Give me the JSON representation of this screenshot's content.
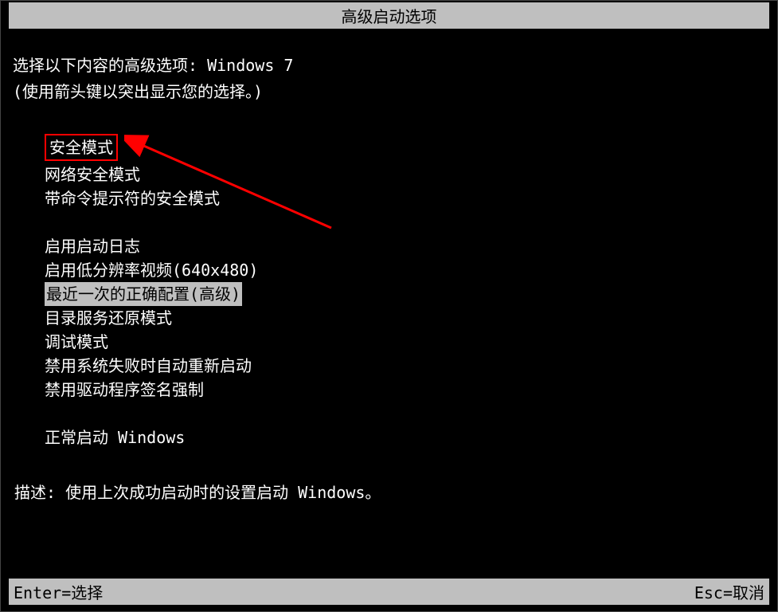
{
  "title": "高级启动选项",
  "prompt": {
    "line1_prefix": "选择以下内容的高级选项: ",
    "os_name": "Windows 7",
    "line2": "(使用箭头键以突出显示您的选择。)"
  },
  "options": {
    "group1": [
      "安全模式",
      "网络安全模式",
      "带命令提示符的安全模式"
    ],
    "group2": [
      "启用启动日志",
      "启用低分辨率视频(640x480)",
      "最近一次的正确配置(高级)",
      "目录服务还原模式",
      "调试模式",
      "禁用系统失败时自动重新启动",
      "禁用驱动程序签名强制"
    ],
    "group3": [
      "正常启动 Windows"
    ]
  },
  "selected_option": "最近一次的正确配置(高级)",
  "boxed_option": "安全模式",
  "description": {
    "label": "描述: ",
    "text": "使用上次成功启动时的设置启动 Windows。"
  },
  "footer": {
    "enter": "Enter=选择",
    "esc": "Esc=取消"
  }
}
